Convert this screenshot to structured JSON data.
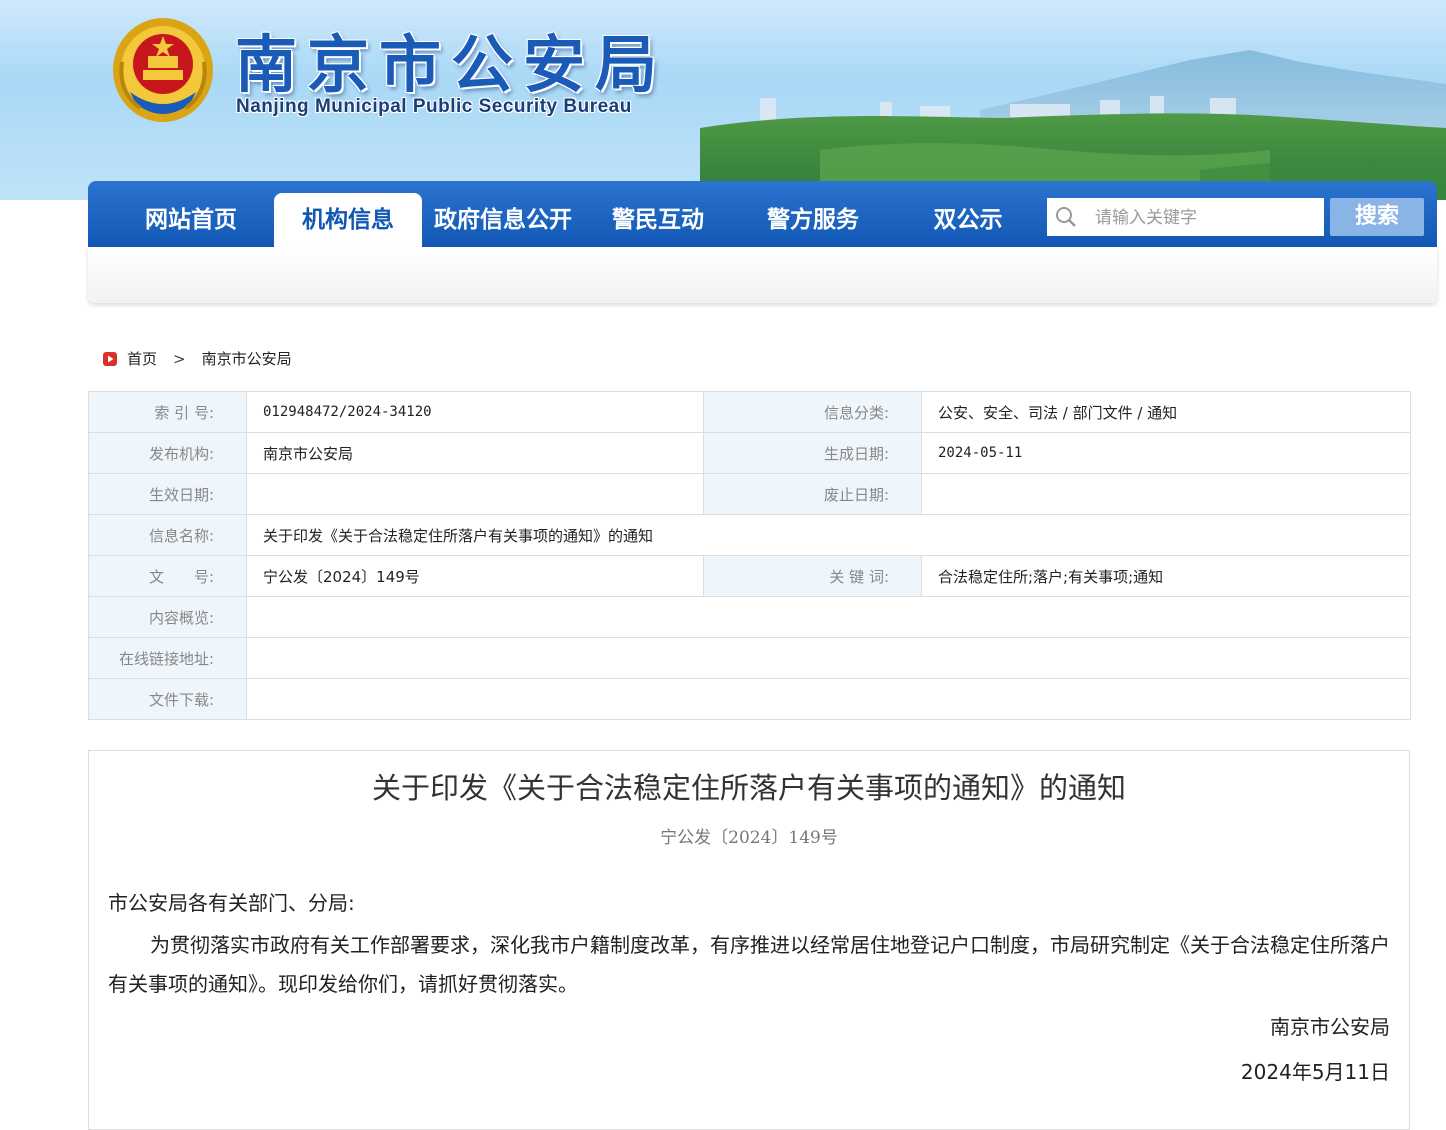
{
  "header": {
    "title": "南京市公安局",
    "subtitle": "Nanjing Municipal Public Security Bureau"
  },
  "nav": {
    "items": [
      {
        "label": "网站首页",
        "active": false
      },
      {
        "label": "机构信息",
        "active": true
      },
      {
        "label": "政府信息公开",
        "active": false
      },
      {
        "label": "警民互动",
        "active": false
      },
      {
        "label": "警方服务",
        "active": false
      },
      {
        "label": "双公示",
        "active": false
      }
    ],
    "search_placeholder": "请输入关键字",
    "search_button": "搜索"
  },
  "breadcrumb": {
    "home": "首页",
    "separator": ">",
    "current": "南京市公安局"
  },
  "info": {
    "index_label": "索 引 号:",
    "index_value": "012948472/2024-34120",
    "category_label": "信息分类:",
    "category_value": "公安、安全、司法 / 部门文件 / 通知",
    "publisher_label": "发布机构:",
    "publisher_value": "南京市公安局",
    "generated_label": "生成日期:",
    "generated_value": "2024-05-11",
    "effective_label": "生效日期:",
    "effective_value": "",
    "expire_label": "废止日期:",
    "expire_value": "",
    "name_label": "信息名称:",
    "name_value": "关于印发《关于合法稳定住所落户有关事项的通知》的通知",
    "docno_label": "文　　号:",
    "docno_value": "宁公发〔2024〕149号",
    "keywords_label": "关 键 词:",
    "keywords_value": "合法稳定住所;落户;有关事项;通知",
    "summary_label": "内容概览:",
    "summary_value": "",
    "link_label": "在线链接地址:",
    "link_value": "",
    "download_label": "文件下载:",
    "download_value": ""
  },
  "article": {
    "title": "关于印发《关于合法稳定住所落户有关事项的通知》的通知",
    "doc_number": "宁公发〔2024〕149号",
    "salutation": "市公安局各有关部门、分局:",
    "body": "为贯彻落实市政府有关工作部署要求，深化我市户籍制度改革，有序推进以经常居住地登记户口制度，市局研究制定《关于合法稳定住所落户有关事项的通知》。现印发给你们，请抓好贯彻落实。",
    "signature": "南京市公安局",
    "date": "2024年5月11日"
  },
  "colors": {
    "nav_blue": "#1257b5",
    "title_blue": "#1a5bb8",
    "label_bg": "#eef5fb",
    "search_button_bg": "#8ab3e6"
  }
}
